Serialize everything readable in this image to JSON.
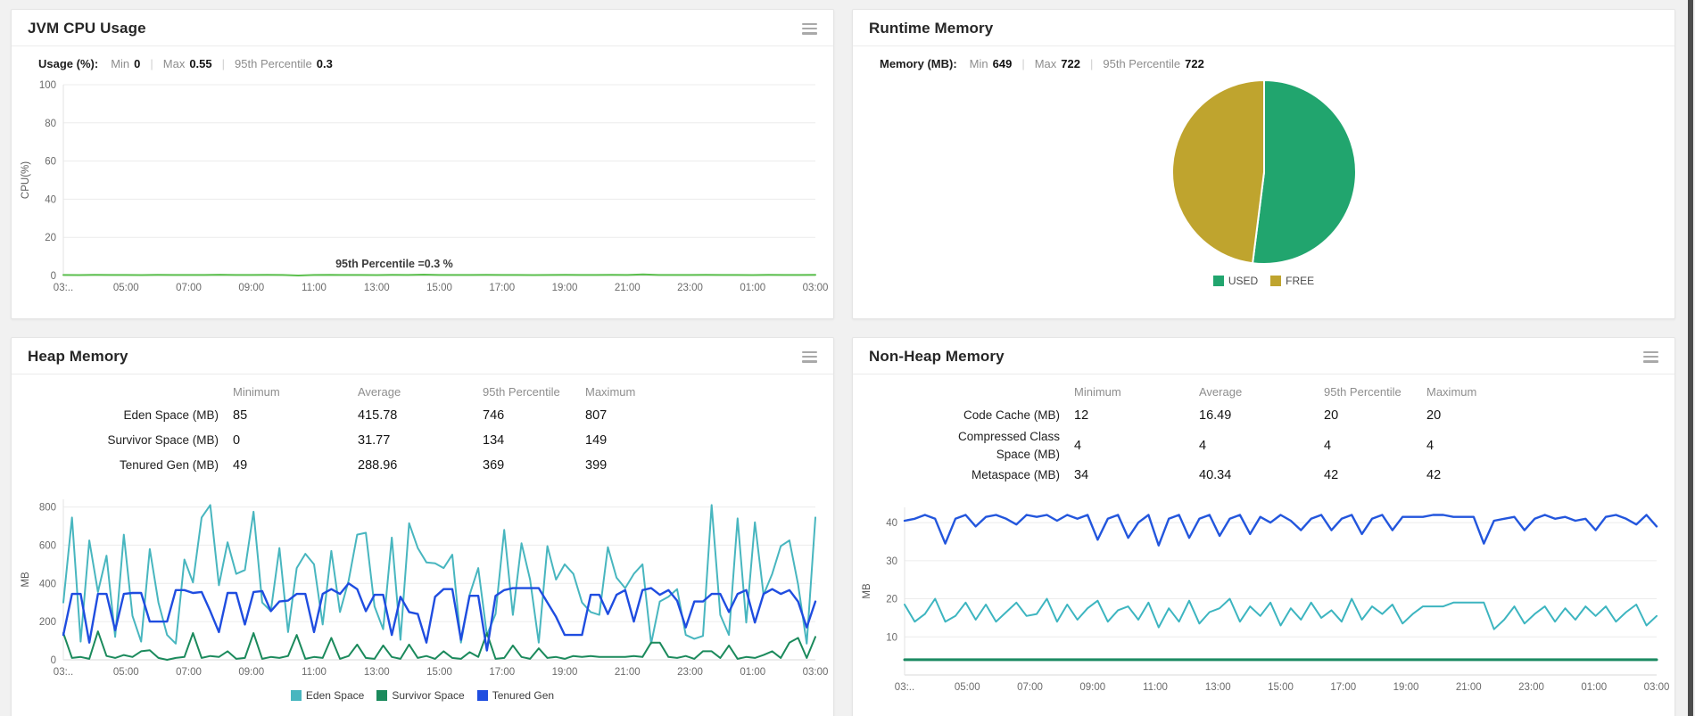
{
  "ui": {
    "sep": "|"
  },
  "panels": {
    "cpu": {
      "title": "JVM CPU Usage",
      "stats": {
        "name": "Usage (%):",
        "min_label": "Min",
        "min": "0",
        "max_label": "Max",
        "max": "0.55",
        "p95_label": "95th Percentile",
        "p95": "0.3"
      }
    },
    "runtime": {
      "title": "Runtime Memory",
      "stats": {
        "name": "Memory (MB):",
        "min_label": "Min",
        "min": "649",
        "max_label": "Max",
        "max": "722",
        "p95_label": "95th Percentile",
        "p95": "722"
      }
    },
    "heap": {
      "title": "Heap Memory"
    },
    "nonheap": {
      "title": "Non-Heap Memory"
    }
  },
  "tables": {
    "heap": {
      "headers": [
        "Minimum",
        "Average",
        "95th Percentile",
        "Maximum"
      ],
      "rows": [
        {
          "label": "Eden Space (MB)",
          "values": [
            "85",
            "415.78",
            "746",
            "807"
          ]
        },
        {
          "label": "Survivor Space (MB)",
          "values": [
            "0",
            "31.77",
            "134",
            "149"
          ]
        },
        {
          "label": "Tenured Gen (MB)",
          "values": [
            "49",
            "288.96",
            "369",
            "399"
          ]
        }
      ]
    },
    "nonheap": {
      "headers": [
        "Minimum",
        "Average",
        "95th Percentile",
        "Maximum"
      ],
      "rows": [
        {
          "label": "Code Cache (MB)",
          "values": [
            "12",
            "16.49",
            "20",
            "20"
          ]
        },
        {
          "label": "Compressed Class\nSpace (MB)",
          "values": [
            "4",
            "4",
            "4",
            "4"
          ]
        },
        {
          "label": "Metaspace (MB)",
          "values": [
            "34",
            "40.34",
            "42",
            "42"
          ]
        }
      ]
    }
  },
  "chart_data": {
    "cpu": {
      "type": "line",
      "ylabel": "CPU(%)",
      "ylim": [
        0,
        100
      ],
      "yticks": [
        0,
        20,
        40,
        60,
        80,
        100
      ],
      "xlabels": [
        "03:..",
        "05:00",
        "07:00",
        "09:00",
        "11:00",
        "13:00",
        "15:00",
        "17:00",
        "19:00",
        "21:00",
        "23:00",
        "01:00",
        "03:00"
      ],
      "annotation": "95th Percentile =0.3 %",
      "series": [
        {
          "name": "CPU Usage",
          "color": "#5bbf4d",
          "width": 2,
          "values": [
            0.3,
            0.25,
            0.32,
            0.28,
            0.3,
            0.22,
            0.35,
            0.3,
            0.26,
            0.3,
            0.4,
            0.3,
            0.27,
            0.33,
            0.3,
            0,
            0.3,
            0.36,
            0.29,
            0.3,
            0.25,
            0.31,
            0.3,
            0.45,
            0.3,
            0.27,
            0.3,
            0.34,
            0.28,
            0.3,
            0.23,
            0.3,
            0.38,
            0.3,
            0.26,
            0.32,
            0.3,
            0.55,
            0.3,
            0.28,
            0.3,
            0.35,
            0.27,
            0.3,
            0.24,
            0.31,
            0.29,
            0.3,
            0.33
          ]
        }
      ]
    },
    "runtime": {
      "type": "pie",
      "slices": [
        {
          "label": "USED",
          "value": 52,
          "color": "#21a56e"
        },
        {
          "label": "FREE",
          "value": 48,
          "color": "#bfa42e"
        }
      ],
      "legend_position": "bottom"
    },
    "heap": {
      "type": "line",
      "ylabel": "MB",
      "ylim": [
        0,
        840
      ],
      "yticks": [
        0,
        200,
        400,
        600,
        800
      ],
      "xlabels": [
        "03:..",
        "05:00",
        "07:00",
        "09:00",
        "11:00",
        "13:00",
        "15:00",
        "17:00",
        "19:00",
        "21:00",
        "23:00",
        "01:00",
        "03:00"
      ],
      "legend": true,
      "series": [
        {
          "name": "Eden Space",
          "color": "#48b6bf",
          "width": 2,
          "values": [
            300,
            745,
            95,
            625,
            355,
            545,
            120,
            655,
            230,
            95,
            580,
            300,
            130,
            85,
            525,
            405,
            745,
            810,
            390,
            615,
            450,
            470,
            775,
            300,
            255,
            585,
            145,
            480,
            555,
            500,
            185,
            570,
            250,
            415,
            655,
            665,
            280,
            160,
            640,
            105,
            715,
            585,
            510,
            505,
            480,
            550,
            90,
            340,
            480,
            130,
            240,
            680,
            235,
            610,
            420,
            90,
            595,
            420,
            500,
            450,
            300,
            250,
            235,
            590,
            430,
            375,
            450,
            500,
            85,
            305,
            330,
            370,
            130,
            110,
            125,
            810,
            235,
            130,
            740,
            195,
            720,
            340,
            450,
            595,
            625,
            395,
            85,
            745
          ]
        },
        {
          "name": "Survivor Space",
          "color": "#1b8a5c",
          "width": 2,
          "values": [
            140,
            10,
            15,
            5,
            149,
            20,
            10,
            25,
            15,
            45,
            50,
            10,
            0,
            10,
            15,
            140,
            10,
            20,
            15,
            45,
            5,
            10,
            140,
            5,
            15,
            10,
            20,
            130,
            5,
            15,
            10,
            115,
            5,
            20,
            80,
            10,
            5,
            75,
            15,
            5,
            80,
            10,
            20,
            5,
            45,
            10,
            5,
            40,
            15,
            140,
            5,
            10,
            75,
            15,
            5,
            60,
            10,
            15,
            5,
            20,
            15,
            20,
            15,
            15,
            15,
            15,
            20,
            15,
            90,
            90,
            15,
            10,
            20,
            5,
            45,
            45,
            10,
            75,
            5,
            15,
            10,
            25,
            45,
            10,
            90,
            115,
            10,
            120
          ]
        },
        {
          "name": "Tenured Gen",
          "color": "#1f4de0",
          "width": 2.4,
          "values": [
            130,
            345,
            345,
            90,
            345,
            345,
            155,
            345,
            350,
            350,
            200,
            200,
            200,
            365,
            365,
            350,
            355,
            255,
            145,
            350,
            350,
            185,
            355,
            360,
            255,
            305,
            310,
            345,
            345,
            145,
            345,
            370,
            345,
            400,
            370,
            255,
            340,
            340,
            130,
            330,
            250,
            240,
            90,
            330,
            370,
            370,
            105,
            335,
            335,
            49,
            335,
            365,
            375,
            375,
            375,
            375,
            300,
            225,
            130,
            130,
            130,
            340,
            340,
            240,
            340,
            365,
            200,
            365,
            375,
            340,
            365,
            310,
            170,
            305,
            305,
            345,
            345,
            250,
            345,
            365,
            195,
            345,
            370,
            345,
            365,
            305,
            170,
            305
          ]
        }
      ]
    },
    "nonheap": {
      "type": "line",
      "ylabel": "MB",
      "ylim": [
        0,
        44
      ],
      "yticks": [
        10,
        20,
        30,
        40
      ],
      "xlabels": [
        "03:..",
        "05:00",
        "07:00",
        "09:00",
        "11:00",
        "13:00",
        "15:00",
        "17:00",
        "19:00",
        "21:00",
        "23:00",
        "01:00",
        "03:00"
      ],
      "series": [
        {
          "name": "Code Cache",
          "color": "#3db5c0",
          "width": 2,
          "values": [
            18.5,
            14,
            16,
            20,
            14,
            15.5,
            19,
            14.5,
            18.5,
            14,
            16.5,
            19,
            15.5,
            16,
            20,
            14,
            18.5,
            14.5,
            17.5,
            19.5,
            14,
            17,
            18,
            14.5,
            19,
            12.5,
            17.5,
            14,
            19.5,
            13.5,
            16.5,
            17.5,
            20,
            14,
            18,
            15.5,
            19,
            13,
            17.5,
            14.5,
            19,
            15,
            17,
            14,
            20,
            14.5,
            18,
            16,
            18.5,
            13.5,
            16,
            18,
            18,
            18,
            19,
            19,
            19,
            19,
            12,
            14.5,
            18,
            13.5,
            16,
            18,
            14,
            17.5,
            14.5,
            18,
            15.5,
            18,
            14,
            16.5,
            18.5,
            13,
            15.5
          ]
        },
        {
          "name": "Compressed Class Space",
          "color": "#1b8a62",
          "width": 3,
          "values": [
            4,
            4
          ]
        },
        {
          "name": "Metaspace",
          "color": "#2356dd",
          "width": 2.4,
          "values": [
            40.5,
            41,
            42,
            41,
            34.5,
            41,
            42,
            39,
            41.5,
            42,
            41,
            39.5,
            42,
            41.5,
            42,
            40.5,
            42,
            41,
            42,
            35.5,
            41,
            42,
            36,
            40,
            42,
            34,
            41,
            42,
            36,
            41,
            42,
            36.5,
            41,
            42,
            37,
            41.5,
            40,
            42,
            40.5,
            38,
            41,
            42,
            38,
            41,
            42,
            37,
            41,
            42,
            38,
            41.5,
            41.5,
            41.5,
            42,
            42,
            41.5,
            41.5,
            41.5,
            34.5,
            40.5,
            41,
            41.5,
            38,
            41,
            42,
            41,
            41.5,
            40.5,
            41,
            38,
            41.5,
            42,
            41,
            39.5,
            42,
            39
          ]
        }
      ]
    }
  }
}
